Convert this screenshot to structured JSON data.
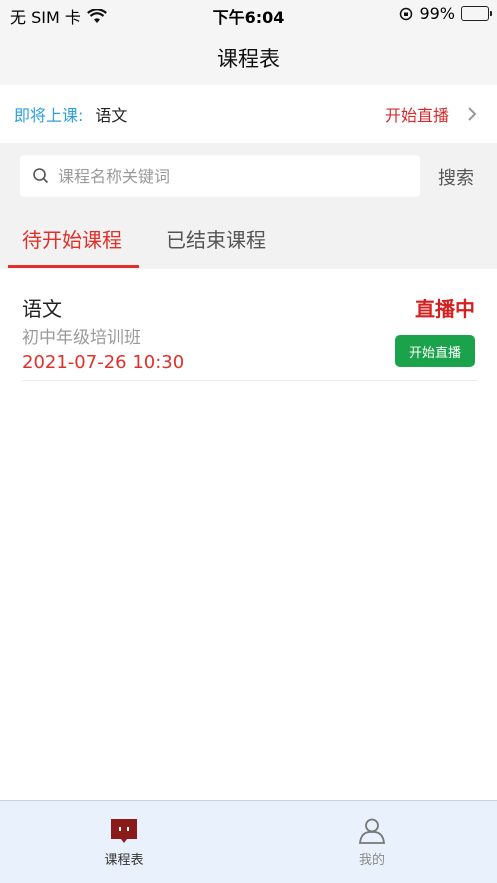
{
  "status_bar": {
    "carrier": "无 SIM 卡",
    "time": "下午6:04",
    "battery": "99%",
    "battery_level": 0.99
  },
  "navbar": {
    "title": "课程表"
  },
  "upcoming": {
    "label": "即将上课:",
    "course": "语文",
    "action": "开始直播"
  },
  "search": {
    "placeholder": "课程名称关键词",
    "button": "搜索"
  },
  "tabs": [
    {
      "label": "待开始课程",
      "active": true
    },
    {
      "label": "已结束课程",
      "active": false
    }
  ],
  "courses": [
    {
      "name": "语文",
      "class": "初中年级培训班",
      "time": "2021-07-26 10:30",
      "status": "直播中",
      "button": "开始直播"
    }
  ],
  "tabbar": {
    "items": [
      {
        "label": "课程表",
        "icon": "schedule-icon",
        "active": true
      },
      {
        "label": "我的",
        "icon": "profile-icon",
        "active": false
      }
    ]
  },
  "colors": {
    "accent_red": "#e0302a",
    "live_green": "#1aa34a",
    "link_blue": "#2d9fe0",
    "tabbar_bg": "#e9f2fc",
    "schedule_icon": "#8b1a1a"
  }
}
